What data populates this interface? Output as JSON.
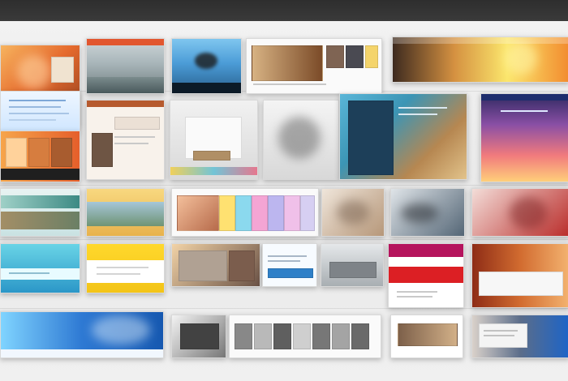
{
  "scene": {
    "colors": {
      "background": "#ececec",
      "topbar": "#2f2f2f",
      "orange": "#e56a2d",
      "teal": "#14a2c8",
      "blue": "#2c78c8",
      "yellow": "#ffd21a",
      "red": "#d8232a",
      "purple": "#6b3f99",
      "pink": "#e66e98"
    },
    "cards": [
      {
        "name": "card-orange-hero",
        "theme": "orange"
      },
      {
        "name": "card-landscape",
        "theme": "gray"
      },
      {
        "name": "card-blue-sky-tree",
        "theme": "blue"
      },
      {
        "name": "card-wide-gallery",
        "theme": "white"
      },
      {
        "name": "card-sunset-banner",
        "theme": "yellow"
      },
      {
        "name": "card-blue-text",
        "theme": "blue"
      },
      {
        "name": "card-orange-sidebar",
        "theme": "orange"
      },
      {
        "name": "card-product-shelf",
        "theme": "white"
      },
      {
        "name": "card-flower",
        "theme": "gray"
      },
      {
        "name": "card-teal-portrait",
        "theme": "teal"
      },
      {
        "name": "card-pink-gradient",
        "theme": "pink"
      },
      {
        "name": "card-small-landscape-1",
        "theme": "teal"
      },
      {
        "name": "card-small-landscape-2",
        "theme": "yellow"
      },
      {
        "name": "card-colorful-grid",
        "theme": "multi"
      },
      {
        "name": "card-warm-figure",
        "theme": "beige"
      },
      {
        "name": "card-hand",
        "theme": "dark"
      },
      {
        "name": "card-red-figure",
        "theme": "red"
      },
      {
        "name": "card-cyan-text",
        "theme": "teal"
      },
      {
        "name": "card-yellow-text",
        "theme": "yellow"
      },
      {
        "name": "card-sepia-collage",
        "theme": "sepia"
      },
      {
        "name": "card-blue-form",
        "theme": "blue"
      },
      {
        "name": "card-road",
        "theme": "gray"
      },
      {
        "name": "card-red-layout",
        "theme": "red"
      },
      {
        "name": "card-rust-texture",
        "theme": "rust"
      },
      {
        "name": "card-blue-wave",
        "theme": "blue"
      },
      {
        "name": "card-bw-strip",
        "theme": "gray"
      },
      {
        "name": "card-bw-gallery",
        "theme": "gray"
      },
      {
        "name": "card-interior",
        "theme": "beige"
      },
      {
        "name": "card-white-list",
        "theme": "white"
      },
      {
        "name": "card-bottom-right",
        "theme": "blue"
      }
    ]
  }
}
